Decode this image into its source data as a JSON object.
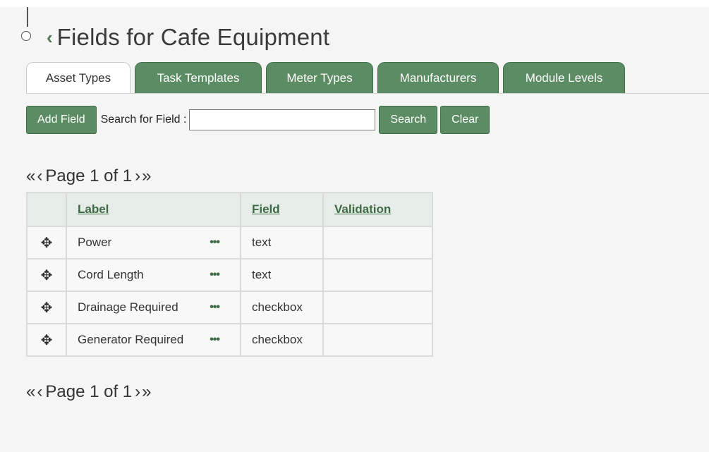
{
  "page": {
    "title": "Fields for Cafe Equipment"
  },
  "tabs": [
    {
      "label": "Asset Types",
      "active": true
    },
    {
      "label": "Task Templates",
      "active": false
    },
    {
      "label": "Meter Types",
      "active": false
    },
    {
      "label": "Manufacturers",
      "active": false
    },
    {
      "label": "Module Levels",
      "active": false
    }
  ],
  "toolbar": {
    "add_field_label": "Add Field",
    "search_label": "Search for Field :",
    "search_value": "",
    "search_button": "Search",
    "clear_button": "Clear"
  },
  "pagination": {
    "text": "Page 1 of 1"
  },
  "table": {
    "headers": {
      "label": "Label",
      "field": "Field",
      "validation": "Validation"
    },
    "rows": [
      {
        "label": "Power",
        "field": "text",
        "validation": ""
      },
      {
        "label": "Cord Length",
        "field": "text",
        "validation": ""
      },
      {
        "label": "Drainage Required",
        "field": "checkbox",
        "validation": ""
      },
      {
        "label": "Generator Required",
        "field": "checkbox",
        "validation": ""
      }
    ]
  },
  "colors": {
    "accent_green": "#5c8c63",
    "link_green": "#3e6b45"
  }
}
